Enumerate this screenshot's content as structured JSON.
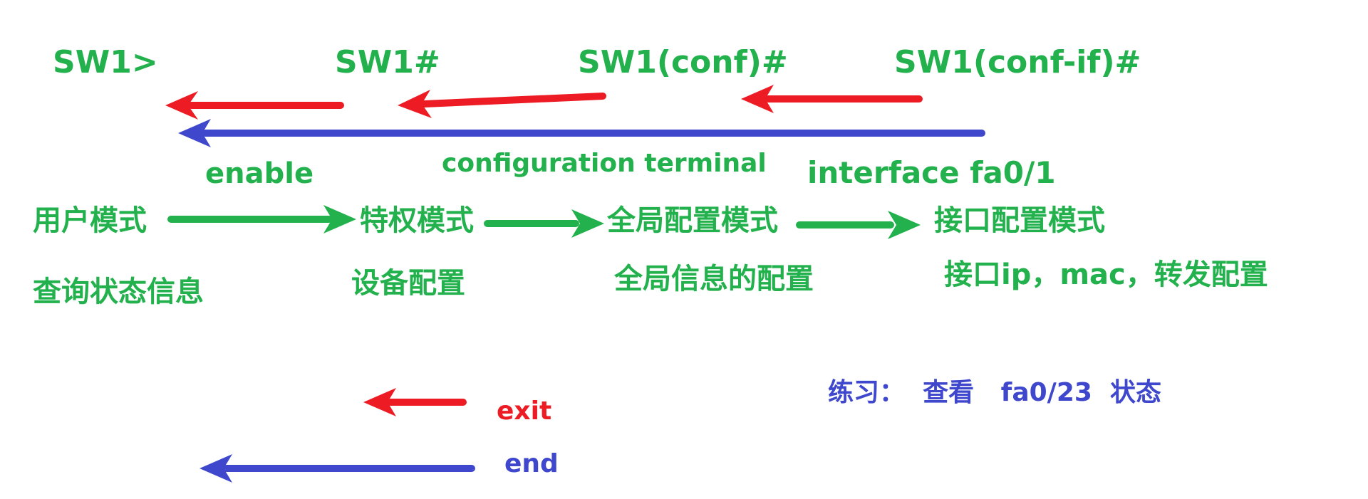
{
  "prompts": {
    "user": "SW1>",
    "privileged": "SW1#",
    "global": "SW1(conf)#",
    "interface": "SW1(conf-if)#"
  },
  "commands": {
    "enable": "enable",
    "configure": "configuration terminal",
    "interface": "interface fa0/1",
    "exit": "exit",
    "end": "end"
  },
  "modes": {
    "user": "用户模式",
    "privileged": "特权模式",
    "global": "全局配置模式",
    "interface": "接口配置模式"
  },
  "descriptions": {
    "user": "查询状态信息",
    "privileged": "设备配置",
    "global": "全局信息的配置",
    "interface": "接口ip，mac，转发配置"
  },
  "exercise": "练习：  查看   fa0/23  状态",
  "colors": {
    "green": "#22b14c",
    "red": "#ed1c24",
    "blue": "#3f48cc"
  }
}
